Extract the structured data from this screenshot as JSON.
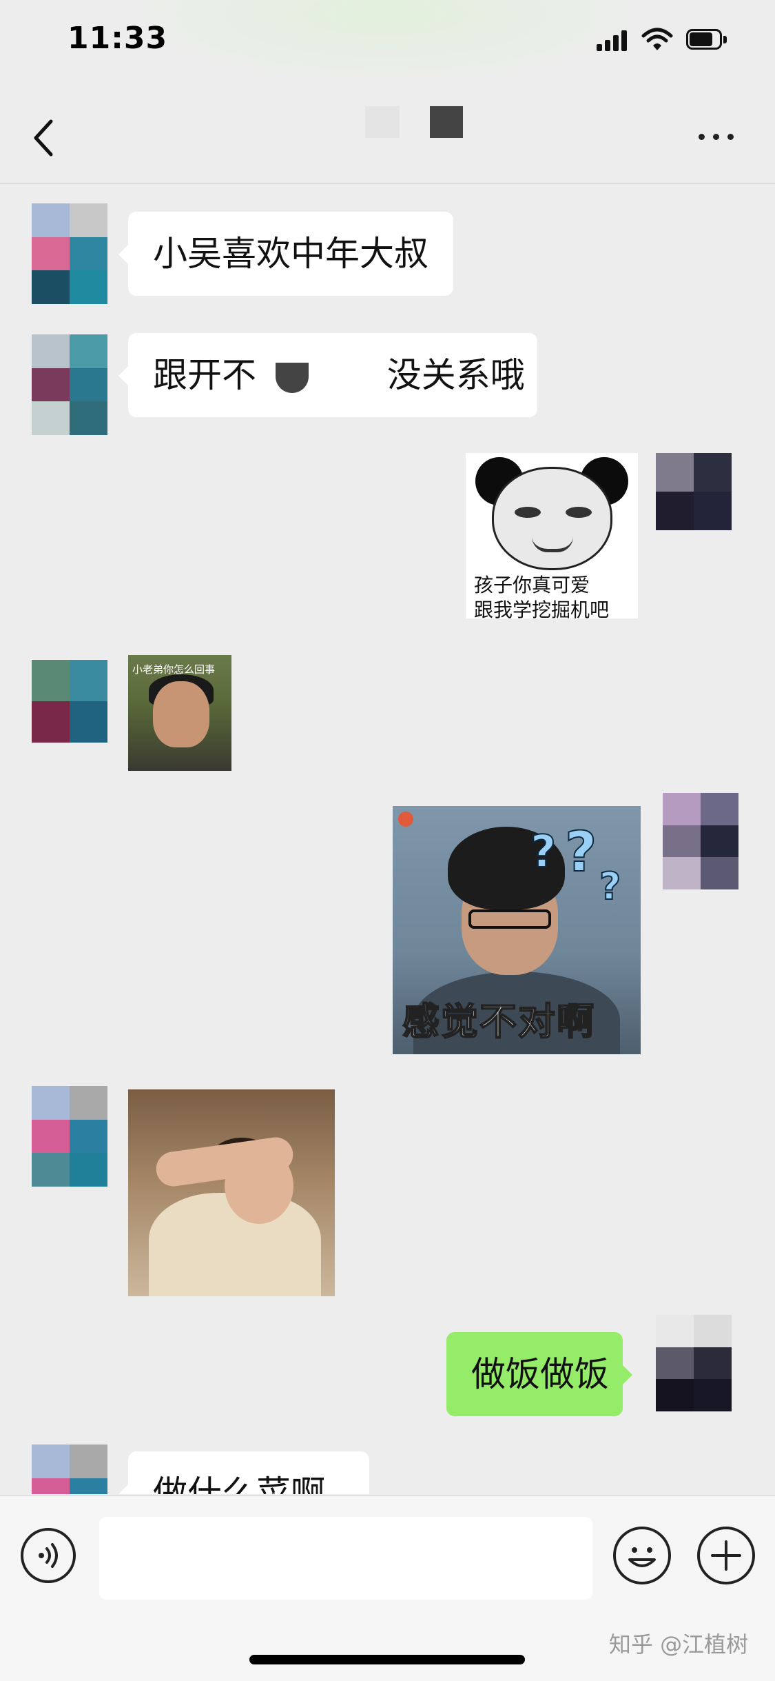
{
  "status_bar": {
    "time": "11:33"
  },
  "colors": {
    "background": "#ededed",
    "incoming_bubble": "#ffffff",
    "outgoing_bubble": "#95ec69"
  },
  "nav": {
    "back_icon": "chevron-left-icon",
    "more_icon": "more-dots-icon"
  },
  "messages": {
    "msg1": {
      "text": "小吴喜欢中年大叔"
    },
    "msg2": {
      "text_a": "跟开不",
      "text_b": "没关系哦"
    },
    "sticker_panda": {
      "line1": "孩子你真可爱",
      "line2": "跟我学挖掘机吧"
    },
    "sticker_boy": {
      "caption": "小老弟你怎么回事"
    },
    "sticker_man": {
      "caption": "感觉不对啊"
    },
    "sticker_woman": {},
    "msg_out": {
      "text": "做饭做饭"
    },
    "msg_last": {
      "text": "做什么菜啊"
    }
  },
  "input_bar": {
    "voice_icon": "voice-icon",
    "emoji_icon": "emoji-icon",
    "plus_icon": "plus-icon",
    "placeholder": ""
  },
  "watermark": "知乎 @江植树"
}
